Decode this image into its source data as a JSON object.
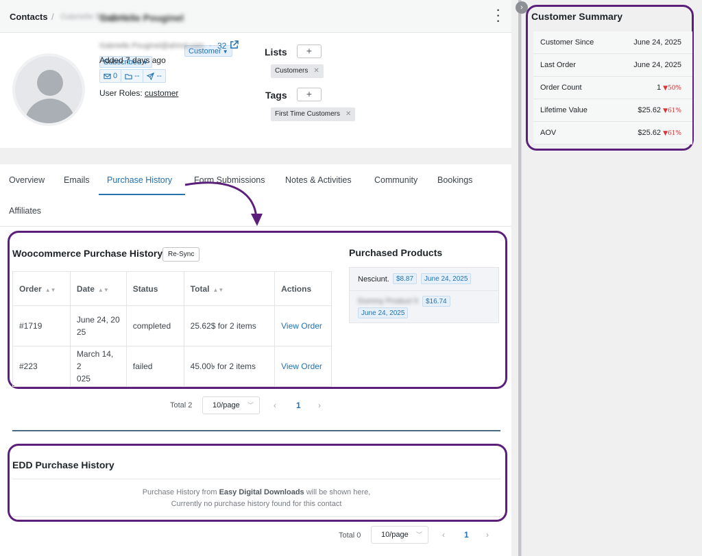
{
  "header": {
    "breadcrumb_root": "Contacts",
    "breadcrumb_sep": "/",
    "contact_name": "Gabrielle Pouginel"
  },
  "profile": {
    "name": "Gabrielle Pouginel",
    "type_badge": "Customer",
    "status_badge": "Subscribed",
    "email": "Gabrielle.Pouginel@ahmd.com",
    "separator": "·",
    "count": "32",
    "added": "Added 7 days ago",
    "stats": {
      "emails": "0",
      "folders": "--",
      "sent": "--"
    },
    "roles_label": "User Roles:",
    "roles_value": "customer"
  },
  "lists": {
    "label": "Lists",
    "add": "+",
    "items": [
      "Customers"
    ]
  },
  "tags": {
    "label": "Tags",
    "add": "+",
    "items": [
      "First Time Customers"
    ]
  },
  "tabs": [
    "Overview",
    "Emails",
    "Purchase History",
    "Form Submissions",
    "Notes & Activities",
    "Community",
    "Bookings",
    "Affiliates"
  ],
  "woo": {
    "title": "Woocommerce Purchase History",
    "resync": "Re-Sync",
    "columns": [
      "Order",
      "Date",
      "Status",
      "Total",
      "Actions"
    ],
    "rows": [
      {
        "order": "#1719",
        "date1": "June 24, 20",
        "date2": "25",
        "status": "completed",
        "total": "25.62$ for 2 items",
        "action": "View Order"
      },
      {
        "order": "#223",
        "date1": "March 14, 2",
        "date2": "025",
        "status": "failed",
        "total": "45.00৳  for 2 items",
        "action": "View Order"
      }
    ],
    "pager": {
      "total": "Total 2",
      "per_page": "10/page",
      "page": "1"
    }
  },
  "purchased": {
    "title": "Purchased Products",
    "items": [
      {
        "name": "Nesciunt.",
        "price": "$8.87",
        "date": "June 24, 2025"
      },
      {
        "name": "Dummy Product 5",
        "price": "$16.74",
        "date": "June 24, 2025"
      }
    ]
  },
  "edd": {
    "title": "EDD Purchase History",
    "line1_pre": "Purchase History from",
    "line1_bold": "Easy Digital Downloads",
    "line1_post": "will be shown here,",
    "line2": "Currently no purchase history found for this contact",
    "pager": {
      "total": "Total 0",
      "per_page": "10/page",
      "page": "1"
    }
  },
  "summary": {
    "title": "Customer Summary",
    "rows": [
      {
        "label": "Customer Since",
        "value": "June 24, 2025",
        "delta": ""
      },
      {
        "label": "Last Order",
        "value": "June 24, 2025",
        "delta": ""
      },
      {
        "label": "Order Count",
        "value": "1",
        "delta": "50%"
      },
      {
        "label": "Lifetime Value",
        "value": "$25.62",
        "delta": "61%"
      },
      {
        "label": "AOV",
        "value": "$25.62",
        "delta": "61%"
      }
    ]
  },
  "colors": {
    "accent": "#2271b1",
    "highlight": "#5b1f7a",
    "negative": "#d63638"
  }
}
